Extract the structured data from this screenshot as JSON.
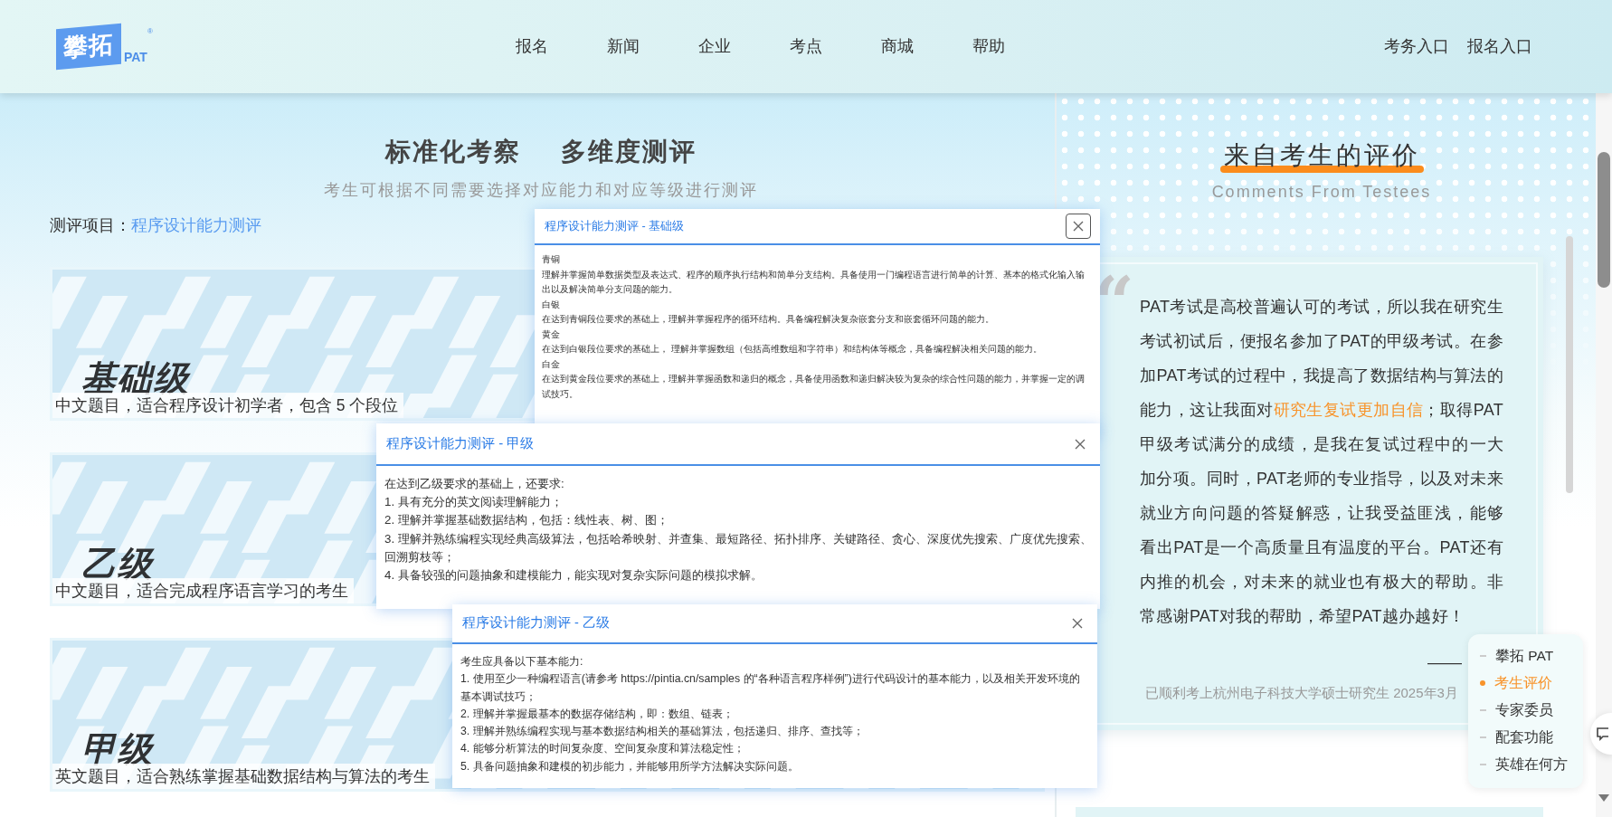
{
  "header": {
    "logo": {
      "name": "攀拓",
      "sub": "PAT",
      "mark": "®"
    },
    "nav": [
      {
        "label": "报名"
      },
      {
        "label": "新闻"
      },
      {
        "label": "企业"
      },
      {
        "label": "考点"
      },
      {
        "label": "商城"
      },
      {
        "label": "帮助"
      }
    ],
    "links": [
      "考务入口",
      "报名入口"
    ]
  },
  "intro": {
    "title_parts": [
      "标准化考察",
      "多维度测评"
    ],
    "subtitle": "考生可根据不同需要选择对应能力和对应等级进行测评",
    "project_label": "测评项目：",
    "project": "程序设计能力测评"
  },
  "levels": [
    {
      "name": "基础级",
      "description": "中文题目，适合程序设计初学者，包含 5 个段位"
    },
    {
      "name": "乙级",
      "description": "中文题目，适合完成程序语言学习的考生"
    },
    {
      "name": "甲级",
      "description": "英文题目，适合熟练掌握基础数据结构与算法的考生"
    }
  ],
  "dialogs": [
    {
      "title": "程序设计能力测评 - 基础级",
      "close_focused": true,
      "lines": [
        "青铜",
        "理解并掌握简单数据类型及表达式、程序的顺序执行结构和简单分支结构。具备使用一门编程语言进行简单的计算、基本的格式化输入输出以及解决简单分支问题的能力。",
        "白银",
        "在达到青铜段位要求的基础上，理解并掌握程序的循环结构。具备编程解决复杂嵌套分支和嵌套循环问题的能力。",
        "黄金",
        "在达到白银段位要求的基础上， 理解并掌握数组（包括高维数组和字符串）和结构体等概念，具备编程解决相关问题的能力。",
        "白金",
        "在达到黄金段位要求的基础上，理解并掌握函数和递归的概念，具备使用函数和递归解决较为复杂的综合性问题的能力，并掌握一定的调试技巧。"
      ]
    },
    {
      "title": "程序设计能力测评 - 甲级",
      "close_focused": false,
      "lines": [
        "在达到乙级要求的基础上，还要求:",
        "1. 具有充分的英文阅读理解能力；",
        "2. 理解并掌握基础数据结构，包括：线性表、树、图；",
        "3. 理解并熟练编程实现经典高级算法，包括哈希映射、并查集、最短路径、拓扑排序、关键路径、贪心、深度优先搜索、广度优先搜索、回溯剪枝等；",
        "4. 具备较强的问题抽象和建模能力，能实现对复杂实际问题的模拟求解。"
      ]
    },
    {
      "title": "程序设计能力测评 - 乙级",
      "close_focused": false,
      "lines": [
        "考生应具备以下基本能力:",
        "1. 使用至少一种编程语言(请参考 https://pintia.cn/samples 的“各种语言程序样例”)进行代码设计的基本能力，以及相关开发环境的基本调试技巧；",
        "2. 理解并掌握最基本的数据存储结构，即：数组、链表；",
        "3. 理解并熟练编程实现与基本数据结构相关的基础算法，包括递归、排序、查找等；",
        "4. 能够分析算法的时间复杂度、空间复杂度和算法稳定性；",
        "5. 具备问题抽象和建模的初步能力，并能够用所学方法解决实际问题。"
      ]
    }
  ],
  "testimonials": {
    "title": "来自考生的评价",
    "subtitle": "Comments From Testees",
    "quote": [
      {
        "text": "PAT考试是高校普遍认可的考试，所以我在研究生考试初试后，便报名参加了PAT的甲级考试。在参加PAT考试的过程中，我提高了数据结构与算法的能力，这让我面对",
        "highlight": false
      },
      {
        "text": "研究生复试更加自信",
        "highlight": true
      },
      {
        "text": "；取得PAT甲级考试满分的成绩，是我在复试过程中的一大加分项。同时，PAT老师的专业指导，以及对未来就业方向问题的答疑解惑，让我受益匪浅，能够看出PAT是一个高质量且有温度的平台。PAT还有内推的机会，对未来的就业也有极大的帮助。非常感谢PAT对我的帮助，希望PAT越办越好！",
        "highlight": false
      }
    ],
    "quote_mark": "“",
    "signature": "——",
    "author_note": "已顺利考上杭州电子科技大学硕士研究生 2025年3月"
  },
  "float_nav": [
    {
      "label": "攀拓 PAT",
      "selected": false
    },
    {
      "label": "考生评价",
      "selected": true
    },
    {
      "label": "专家委员",
      "selected": false
    },
    {
      "label": "配套功能",
      "selected": false
    },
    {
      "label": "英雄在何方",
      "selected": false
    }
  ]
}
